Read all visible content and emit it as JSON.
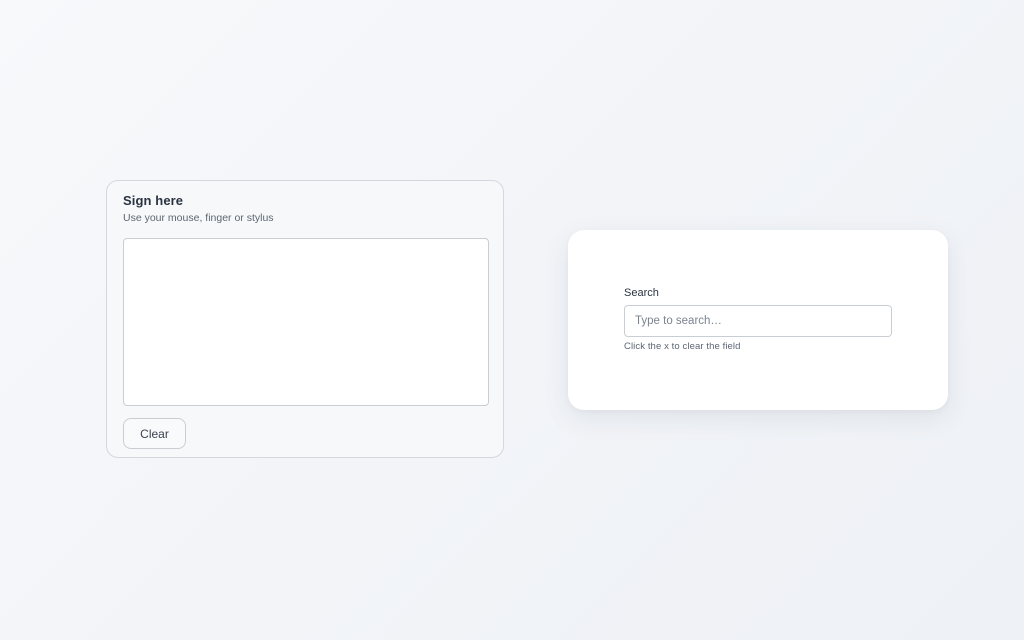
{
  "signature": {
    "title": "Sign here",
    "subtitle": "Use your mouse, finger or stylus",
    "clear_label": "Clear"
  },
  "search": {
    "label": "Search",
    "placeholder": "Type to search…",
    "value": "",
    "hint": "Click the x to clear the field"
  }
}
